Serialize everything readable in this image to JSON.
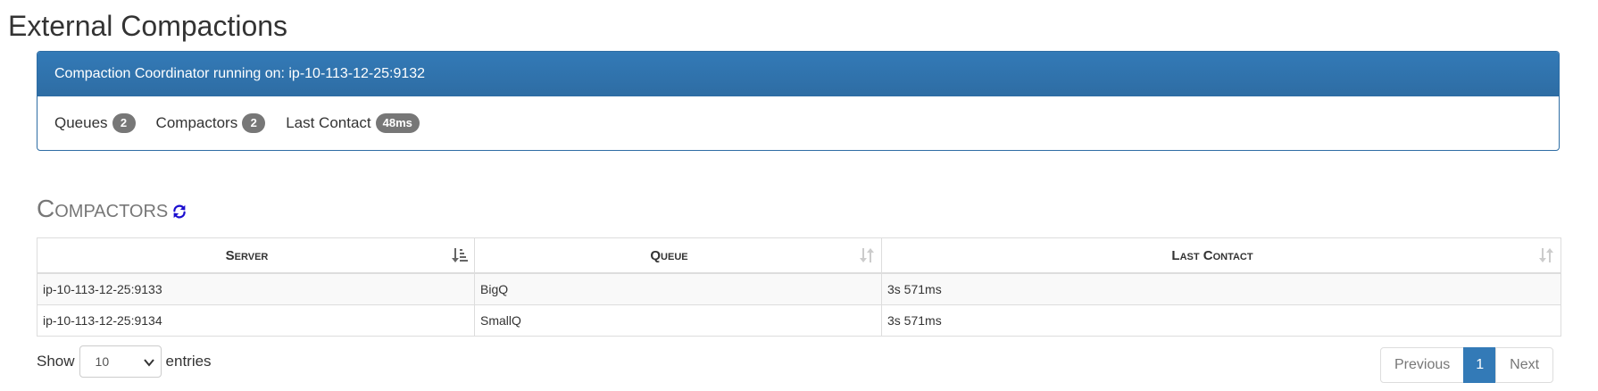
{
  "page": {
    "title": "External Compactions"
  },
  "coordinator": {
    "heading": "Compaction Coordinator running on: ip-10-113-12-25:9132",
    "stats": [
      {
        "label": "Queues",
        "value": "2"
      },
      {
        "label": "Compactors",
        "value": "2"
      },
      {
        "label": "Last Contact",
        "value": "48ms"
      }
    ]
  },
  "compactors": {
    "title": "Compactors",
    "refresh_icon": "refresh-icon",
    "columns": [
      {
        "label": "Server",
        "sort": "ascending"
      },
      {
        "label": "Queue",
        "sort": "none"
      },
      {
        "label": "Last Contact",
        "sort": "none"
      }
    ],
    "rows": [
      {
        "server": "ip-10-113-12-25:9133",
        "queue": "BigQ",
        "last_contact": "3s 571ms"
      },
      {
        "server": "ip-10-113-12-25:9134",
        "queue": "SmallQ",
        "last_contact": "3s 571ms"
      }
    ],
    "length": {
      "prefix": "Show",
      "selected": "10",
      "suffix": "entries"
    },
    "pagination": {
      "previous": "Previous",
      "current": "1",
      "next": "Next"
    }
  },
  "colors": {
    "primary": "#337ab7",
    "badge": "#777777",
    "refresh_icon": "#1a0dcf"
  }
}
